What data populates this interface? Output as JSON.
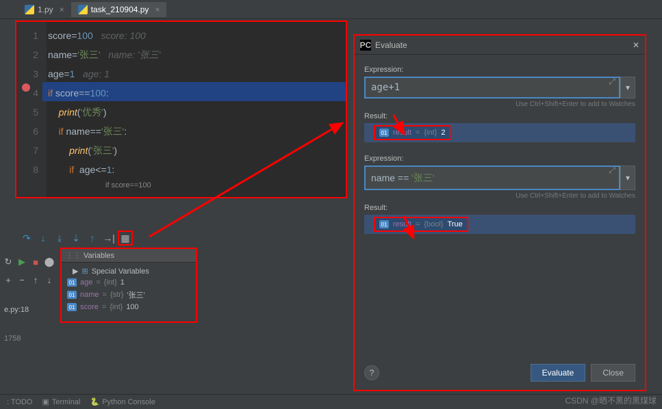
{
  "tabs": [
    {
      "name": "1.py",
      "active": false
    },
    {
      "name": "task_210904.py",
      "active": true
    }
  ],
  "code": {
    "lines": [
      "1",
      "2",
      "3",
      "4",
      "5",
      "6",
      "7",
      "8"
    ],
    "l1_a": "score=",
    "l1_b": "100",
    "l1_hint": "score: 100",
    "l2_a": "name=",
    "l2_b": "'张三'",
    "l2_hint": "name: '张三'",
    "l3_a": "age=",
    "l3_b": "1",
    "l3_hint": "age: 1",
    "l4_if": "if ",
    "l4_cond": "score==",
    "l4_v": "100",
    "l4_c": ":",
    "l5_ind": "    ",
    "l5_fn": "print",
    "l5_p": "(",
    "l5_s": "'优秀'",
    "l5_p2": ")",
    "l6_ind": "    ",
    "l6_if": "if ",
    "l6_c": "name==",
    "l6_s": "'张三'",
    "l6_co": ":",
    "l7_ind": "        ",
    "l7_fn": "print",
    "l7_p": "(",
    "l7_s": "'张三'",
    "l7_p2": ")",
    "l8_ind": "        ",
    "l8_if": "if ",
    "l8_c": " age<=",
    "l8_v": "1",
    "l8_co": ":",
    "breadcrumb": "if score==100"
  },
  "variables": {
    "title": "Variables",
    "special": "Special Variables",
    "rows": [
      {
        "name": "age",
        "eq": " = ",
        "type": "{int}",
        "val": " 1"
      },
      {
        "name": "name",
        "eq": " = ",
        "type": "{str}",
        "val": " '张三'"
      },
      {
        "name": "score",
        "eq": " = ",
        "type": "{int}",
        "val": " 100"
      }
    ]
  },
  "frame": {
    "file": "e.py:18",
    "num": "1758"
  },
  "bottom": {
    "todo": ": TODO",
    "terminal": "Terminal",
    "console": "Python Console"
  },
  "evaluate": {
    "title": "Evaluate",
    "expr_label": "Expression:",
    "expr1": "age+1",
    "hint": "Use Ctrl+Shift+Enter to add to Watches",
    "res_label": "Result:",
    "res1_name": "result",
    "res1_eq": " = ",
    "res1_type": "{int}",
    "res1_val": " 2",
    "expr2": "name == '张三'",
    "res2_name": "result",
    "res2_eq": " = ",
    "res2_type": "{bool}",
    "res2_val": " True",
    "btn_eval": "Evaluate",
    "btn_close": "Close",
    "help": "?"
  },
  "watermark": "CSDN @晒不黑的黑煤球"
}
